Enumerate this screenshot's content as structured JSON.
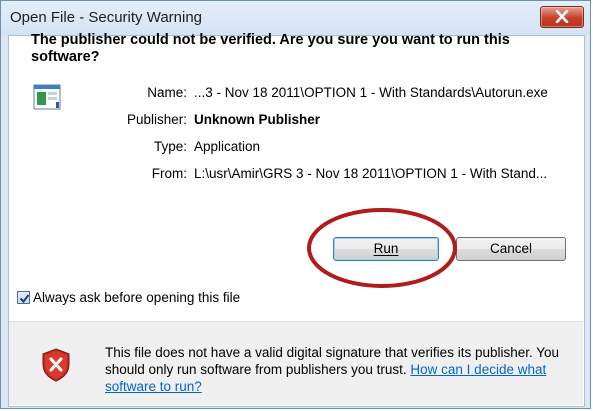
{
  "window": {
    "title": "Open File - Security Warning"
  },
  "dialog": {
    "question": "The publisher could not be verified.  Are you sure you want to run this software?",
    "fields": {
      "name_label": "Name:",
      "name_value": "...3 - Nov 18 2011\\OPTION 1 - With Standards\\Autorun.exe",
      "publisher_label": "Publisher:",
      "publisher_value": "Unknown Publisher",
      "type_label": "Type:",
      "type_value": "Application",
      "from_label": "From:",
      "from_value": "L:\\usr\\Amir\\GRS 3 - Nov 18 2011\\OPTION 1 - With Stand..."
    },
    "buttons": {
      "run_label": "Run",
      "cancel_label": "Cancel"
    },
    "checkbox": {
      "label": "Always ask before opening this file",
      "checked": true
    },
    "warning": {
      "text": "This file does not have a valid digital signature that verifies its publisher. You should only run software from publishers you trust.",
      "link": "How can I decide what software to run?"
    }
  },
  "icons": {
    "close": "close-icon",
    "file": "application-file-icon",
    "shield": "security-shield-error-icon"
  },
  "colors": {
    "titlebar": "#d4e3f3",
    "close_button": "#c6402a",
    "annotation": "#b01c1c",
    "link": "#0066cc"
  }
}
